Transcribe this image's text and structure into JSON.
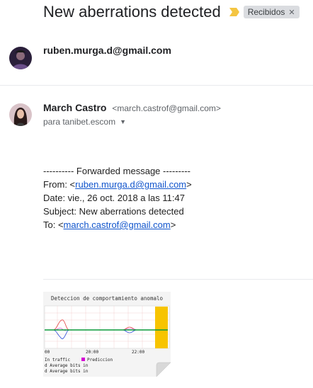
{
  "subject": "New aberrations detected",
  "label": "Recibidos",
  "colors": {
    "important_marker": "#f4c542",
    "link": "#1155cc",
    "chart_highlight": "#f7c400"
  },
  "message1": {
    "sender": "ruben.murga.d@gmail.com"
  },
  "message2": {
    "sender_name": "March Castro",
    "sender_email": "<march.castrof@gmail.com>",
    "recipient": "para tanibet.escom",
    "body": {
      "fwd_header": "---------- Forwarded message ---------",
      "from_label": "From: <",
      "from_email": "ruben.murga.d@gmail.com",
      "from_tail": ">",
      "date": "Date: vie., 26 oct. 2018 a las 11:47",
      "subject": "Subject: New aberrations detected",
      "to_label": "To: <",
      "to_email": "march.castrof@gmail.com",
      "to_tail": ">"
    }
  },
  "attachment": {
    "title": "Deteccion de comportamiento anomalo",
    "tick_labels": [
      "00",
      "20:00",
      "22:00"
    ],
    "legend_in": "In traffic",
    "legend_pred": "Prediccion",
    "line3": "d Average bits in",
    "line4": "d Average bits in"
  },
  "icons": {
    "dropdown": "chevron-down-icon",
    "chip_close": "close-icon"
  }
}
